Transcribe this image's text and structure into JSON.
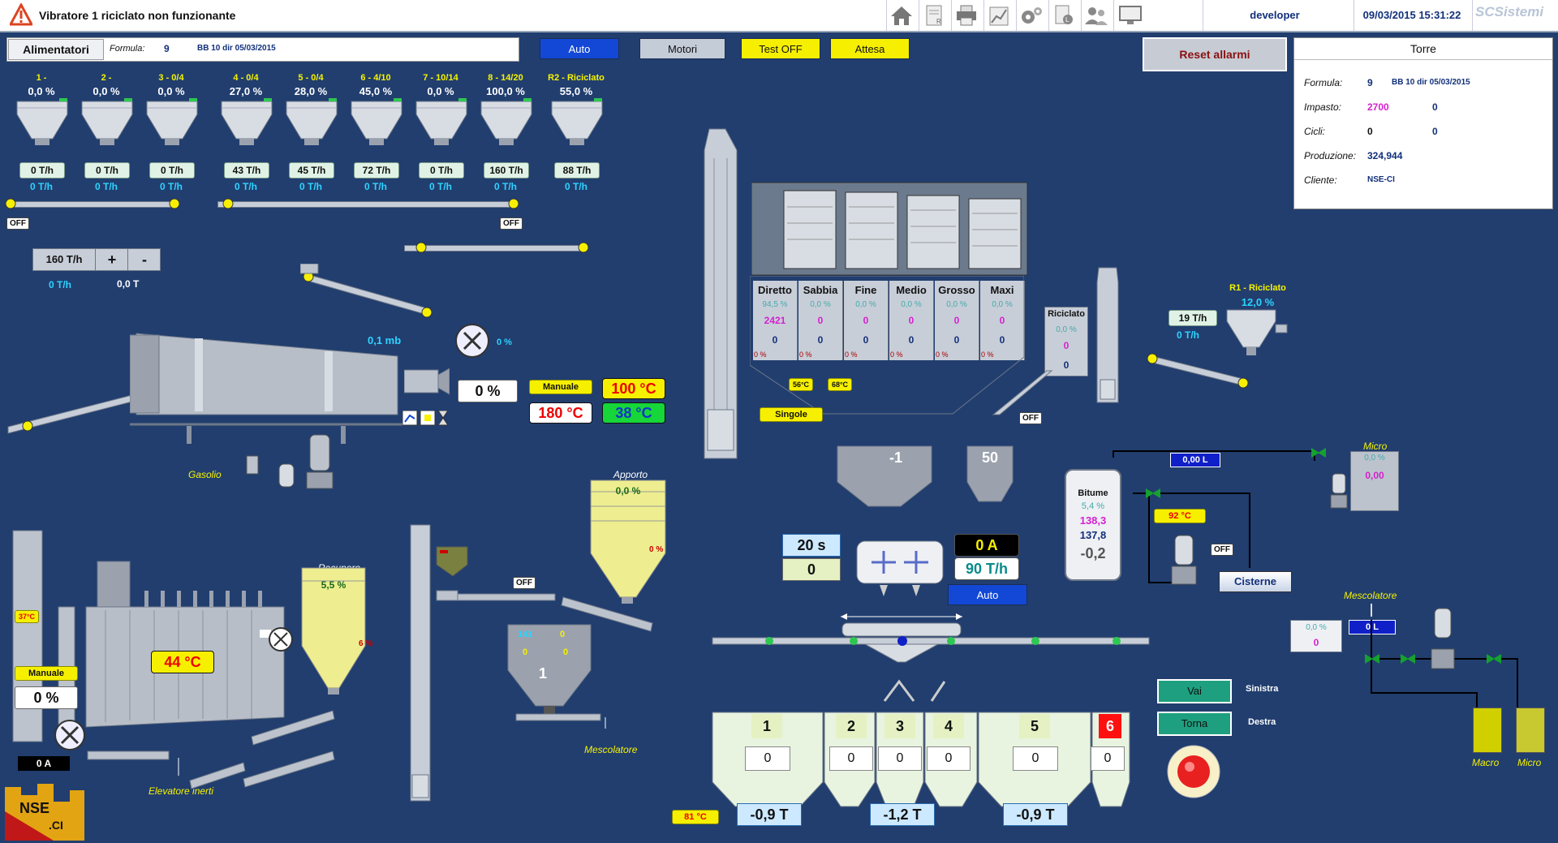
{
  "topbar": {
    "alarm_text": "Vibratore 1 riciclato non funzionante",
    "user": "developer",
    "datetime": "09/03/2015 15:31:22",
    "brand": "SCSistemi"
  },
  "header": {
    "feeders_label": "Alimentatori",
    "formula_label": "Formula:",
    "formula_num": "9",
    "formula_name": "BB 10 dir 05/03/2015",
    "auto": "Auto",
    "motori": "Motori",
    "test_off": "Test OFF",
    "attesa": "Attesa",
    "reset_allarmi": "Reset allarmi"
  },
  "torre": {
    "title": "Torre",
    "formula_label": "Formula:",
    "formula_num": "9",
    "formula_name": "BB 10 dir 05/03/2015",
    "impasto_label": "Impasto:",
    "impasto_a": "2700",
    "impasto_b": "0",
    "cicli_label": "Cicli:",
    "cicli_a": "0",
    "cicli_b": "0",
    "produzione_label": "Produzione:",
    "produzione": "324,944",
    "cliente_label": "Cliente:",
    "cliente": "NSE-CI"
  },
  "feeders": [
    {
      "name": "1 -",
      "pct": "0,0 %",
      "set": "0 T/h",
      "real": "0 T/h"
    },
    {
      "name": "2 -",
      "pct": "0,0 %",
      "set": "0 T/h",
      "real": "0 T/h"
    },
    {
      "name": "3 - 0/4",
      "pct": "0,0 %",
      "set": "0 T/h",
      "real": "0 T/h"
    },
    {
      "name": "4 - 0/4",
      "pct": "27,0 %",
      "set": "43 T/h",
      "real": "0 T/h"
    },
    {
      "name": "5 - 0/4",
      "pct": "28,0 %",
      "set": "45 T/h",
      "real": "0 T/h"
    },
    {
      "name": "6 - 4/10",
      "pct": "45,0 %",
      "set": "72 T/h",
      "real": "0 T/h"
    },
    {
      "name": "7 - 10/14",
      "pct": "0,0 %",
      "set": "0 T/h",
      "real": "0 T/h"
    },
    {
      "name": "8 - 14/20",
      "pct": "100,0 %",
      "set": "160 T/h",
      "real": "0 T/h"
    },
    {
      "name": "R2 - Riciclato",
      "pct": "55,0 %",
      "set": "88 T/h",
      "real": "0 T/h"
    }
  ],
  "feeder_ctrl": {
    "off1": "OFF",
    "off2": "OFF",
    "rate": "160 T/h",
    "plus": "+",
    "minus": "-",
    "real": "0 T/h",
    "total": "0,0 T"
  },
  "dryer": {
    "pressure": "0,1 mb",
    "fan_pct": "0 %",
    "burner_pct": "0 %",
    "manuale": "Manuale",
    "temp1": "100 °C",
    "temp2": "180 °C",
    "temp3": "38 °C",
    "gasolio": "Gasolio"
  },
  "screens": {
    "columns": [
      {
        "name": "Diretto",
        "pct": "94,5 %",
        "val": "2421",
        "b": "0",
        "low": "0 %"
      },
      {
        "name": "Sabbia",
        "pct": "0,0 %",
        "val": "0",
        "b": "0",
        "low": "0 %"
      },
      {
        "name": "Fine",
        "pct": "0,0 %",
        "val": "0",
        "b": "0",
        "low": "0 %"
      },
      {
        "name": "Medio",
        "pct": "0,0 %",
        "val": "0",
        "b": "0",
        "low": "0 %"
      },
      {
        "name": "Grosso",
        "pct": "0,0 %",
        "val": "0",
        "b": "0",
        "low": "0 %"
      },
      {
        "name": "Maxi",
        "pct": "0,0 %",
        "val": "0",
        "b": "0",
        "low": "0 %"
      }
    ],
    "temp_a": "56°C",
    "temp_b": "68°C",
    "singole": "Singole",
    "off": "OFF"
  },
  "riciclato": {
    "name": "Riciclato",
    "pct": "0,0 %",
    "val": "0",
    "b": "0"
  },
  "r1": {
    "name": "R1 - Riciclato",
    "pct": "12,0 %",
    "set": "19 T/h",
    "real": "0 T/h"
  },
  "weigh": {
    "agg": "-1",
    "filler": "50",
    "time": "20 s",
    "count": "0",
    "amp": "0 A",
    "rate": "90 T/h",
    "auto": "Auto"
  },
  "bitume": {
    "label": "Bitume",
    "pct": "5,4 %",
    "v1": "138,3",
    "v2": "137,8",
    "v3": "-0,2",
    "temp": "92 °C",
    "off": "OFF",
    "cisterne": "Cisterne",
    "flow": "0,00 L"
  },
  "micro": {
    "label": "Micro",
    "pct": "0,0 %",
    "val": "0,00"
  },
  "mescolatore": {
    "label": "Mescolatore",
    "pct": "0,0 %",
    "val": "0",
    "liters": "0 L",
    "macro": "Macro",
    "micro": "Micro"
  },
  "filter": {
    "temp": "37°C",
    "manuale": "Manuale",
    "pct": "0 %",
    "amp": "0 A",
    "bag_temp": "44 °C",
    "elevatore": "Elevatore inerti"
  },
  "recupero": {
    "label": "Recupero",
    "pct": "5,5 %",
    "low": "6 %"
  },
  "apporto": {
    "label": "Apporto",
    "pct": "0,0 %",
    "low": "0 %",
    "off": "OFF"
  },
  "small_silo": {
    "a": "141",
    "b": "0",
    "c": "0",
    "d": "0",
    "num": "1",
    "mescolatore": "Mescolatore"
  },
  "bins": {
    "items": [
      {
        "num": "1",
        "val": "0"
      },
      {
        "num": "2",
        "val": "0"
      },
      {
        "num": "3",
        "val": "0"
      },
      {
        "num": "4",
        "val": "0"
      },
      {
        "num": "5",
        "val": "0"
      },
      {
        "num": "6",
        "val": "0"
      }
    ],
    "t1": "-0,9 T",
    "t2": "-1,2 T",
    "t3": "-0,9 T",
    "temp": "81 °C"
  },
  "cart": {
    "vai": "Vai",
    "torna": "Torna",
    "sinistra": "Sinistra",
    "destra": "Destra"
  },
  "logo": {
    "text": "NSE.CI"
  }
}
